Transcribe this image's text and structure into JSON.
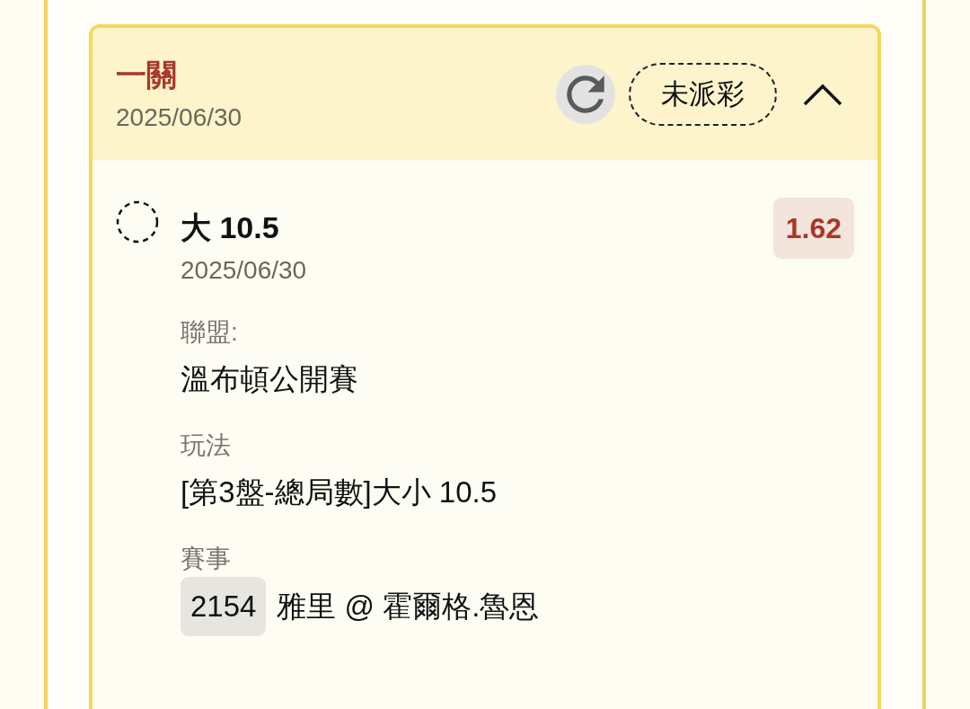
{
  "bet": {
    "bet_type": "一關",
    "date": "2025/06/30",
    "status": "未派彩",
    "settled": false,
    "expanded": true,
    "selections": [
      {
        "pick": "大 10.5",
        "date": "2025/06/30",
        "odds": "1.62",
        "settled": false,
        "details": [
          {
            "kind": "text",
            "label": "聯盟:",
            "value": "溫布頓公開賽"
          },
          {
            "kind": "text",
            "label": "玩法",
            "value": "[第3盤-總局數]大小 10.5"
          },
          {
            "kind": "match",
            "label": "賽事",
            "match_no": "2154",
            "value": "雅里 @ 霍爾格.魯恩"
          }
        ]
      }
    ]
  }
}
